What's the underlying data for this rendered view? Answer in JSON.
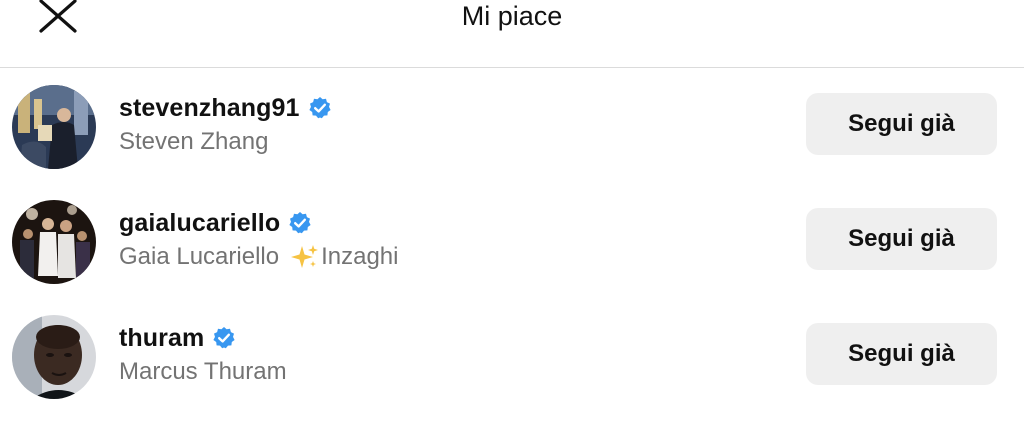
{
  "header": {
    "title": "Mi piace",
    "close_icon": "close-icon"
  },
  "users": [
    {
      "username": "stevenzhang91",
      "verified": true,
      "fullname": "Steven Zhang",
      "button_label": "Segui già"
    },
    {
      "username": "gaialucariello",
      "verified": true,
      "fullname": "Gaia Lucariello",
      "fullname_suffix": "Inzaghi",
      "has_sparkle": true,
      "button_label": "Segui già"
    },
    {
      "username": "thuram",
      "verified": true,
      "fullname": "Marcus Thuram",
      "button_label": "Segui già"
    }
  ],
  "colors": {
    "verified_blue": "#3897f0",
    "secondary_text": "#737373",
    "button_bg": "#efefef",
    "divider": "#dbdbdb"
  }
}
